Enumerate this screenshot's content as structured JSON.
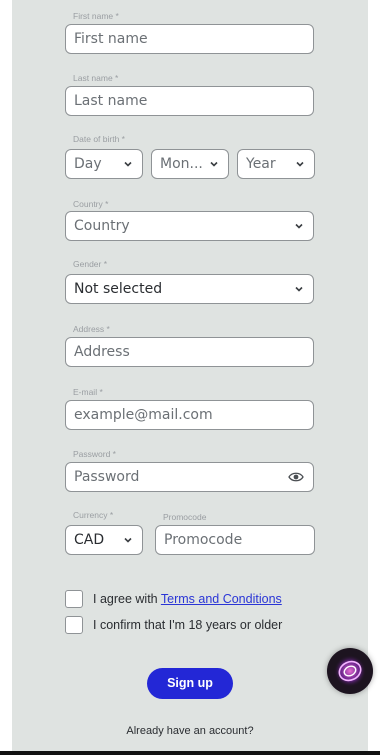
{
  "form": {
    "first_name": {
      "label": "First name *",
      "placeholder": "First name"
    },
    "last_name": {
      "label": "Last name *",
      "placeholder": "Last name"
    },
    "dob": {
      "label": "Date of birth *",
      "day": "Day",
      "month": "Mon...",
      "year": "Year"
    },
    "country": {
      "label": "Country *",
      "value": "Country"
    },
    "gender": {
      "label": "Gender *",
      "value": "Not selected"
    },
    "address": {
      "label": "Address *",
      "placeholder": "Address"
    },
    "email": {
      "label": "E-mail *",
      "placeholder": "example@mail.com"
    },
    "password": {
      "label": "Password *",
      "placeholder": "Password"
    },
    "currency": {
      "label": "Currency *",
      "value": "CAD"
    },
    "promocode": {
      "label": "Promocode",
      "placeholder": "Promocode"
    }
  },
  "agree": {
    "text": "I agree with ",
    "link": "Terms and Conditions"
  },
  "age_confirm": {
    "text": "I confirm that I'm 18 years or older"
  },
  "signup_label": "Sign up",
  "already_text": "Already have an account?",
  "colors": {
    "accent": "#2327d6",
    "panel": "#dfe3e1",
    "link": "#2a35d6"
  },
  "icons": {
    "dropdown": "chevron-down-icon",
    "reveal": "eye-icon",
    "chat": "chat-logo-icon"
  }
}
